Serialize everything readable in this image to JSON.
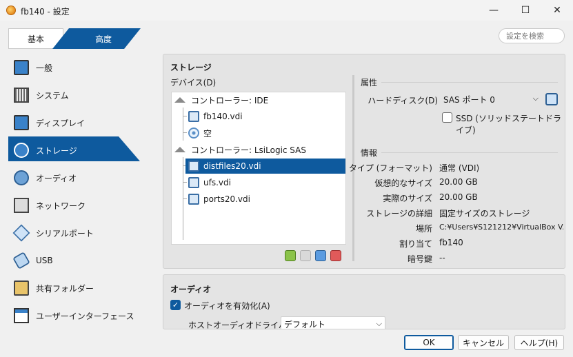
{
  "window": {
    "title": "fb140 - 設定",
    "minimize": "—",
    "maximize": "☐",
    "close": "✕"
  },
  "mode_tabs": {
    "basic": "基本",
    "advanced": "高度"
  },
  "search": {
    "placeholder": "設定を検索"
  },
  "sidebar": {
    "items": [
      {
        "label": "一般",
        "icon": "monitor-icon"
      },
      {
        "label": "システム",
        "icon": "chip-icon"
      },
      {
        "label": "ディスプレイ",
        "icon": "display-icon"
      },
      {
        "label": "ストレージ",
        "icon": "disk-icon",
        "active": true
      },
      {
        "label": "オーディオ",
        "icon": "speaker-icon"
      },
      {
        "label": "ネットワーク",
        "icon": "network-icon"
      },
      {
        "label": "シリアルポート",
        "icon": "serial-icon"
      },
      {
        "label": "USB",
        "icon": "usb-icon"
      },
      {
        "label": "共有フォルダー",
        "icon": "folder-icon"
      },
      {
        "label": "ユーザーインターフェース",
        "icon": "window-icon"
      }
    ]
  },
  "storage": {
    "header": "ストレージ",
    "devices_label": "デバイス(D)",
    "tree": [
      {
        "label": "コントローラー: IDE",
        "type": "controller"
      },
      {
        "label": "fb140.vdi",
        "type": "disk"
      },
      {
        "label": "空",
        "type": "optical"
      },
      {
        "label": "コントローラー: LsiLogic SAS",
        "type": "controller"
      },
      {
        "label": "distfiles20.vdi",
        "type": "disk",
        "selected": true
      },
      {
        "label": "ufs.vdi",
        "type": "disk"
      },
      {
        "label": "ports20.vdi",
        "type": "disk"
      }
    ],
    "attributes": {
      "header": "属性",
      "hard_disk_label": "ハードディスク(D)",
      "hard_disk_value": "SAS ポート 0",
      "ssd_label": "SSD (ソリッドステートドライブ)",
      "ssd_checked": false
    },
    "info": {
      "header": "情報",
      "rows": [
        {
          "label": "タイプ (フォーマット)",
          "value": "通常 (VDI)"
        },
        {
          "label": "仮想的なサイズ",
          "value": "20.00 GB"
        },
        {
          "label": "実際のサイズ",
          "value": "20.00 GB"
        },
        {
          "label": "ストレージの詳細",
          "value": "固定サイズのストレージ"
        },
        {
          "label": "場所",
          "value": "C:¥Users¥S121212¥VirtualBox V..."
        },
        {
          "label": "割り当て",
          "value": "fb140"
        },
        {
          "label": "暗号鍵",
          "value": "--"
        }
      ]
    }
  },
  "audio": {
    "header": "オーディオ",
    "enable_label": "オーディオを有効化(A)",
    "enable_checked": true,
    "driver_label": "ホストオーディオドライバー(D)",
    "driver_value": "デフォルト"
  },
  "footer": {
    "ok": "OK",
    "cancel": "キャンセル",
    "help": "ヘルプ(H)"
  },
  "colors": {
    "accent": "#0e5a9e"
  }
}
